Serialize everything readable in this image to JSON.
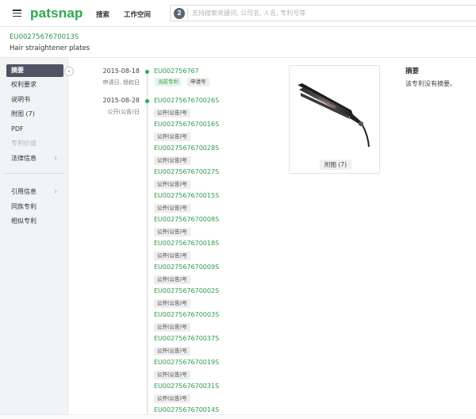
{
  "header": {
    "logo": "patsnap",
    "nav": [
      "搜索",
      "工作空间"
    ],
    "search": {
      "badge": "2",
      "placeholder": "支持搜索关键词, 公司名, 人名, 专利号等"
    }
  },
  "patent": {
    "number": "EU0027567670013S",
    "title": "Hair straightener plates"
  },
  "sidebar": {
    "items": [
      {
        "label": "摘要",
        "state": "active"
      },
      {
        "label": "权利要求",
        "state": "normal"
      },
      {
        "label": "说明书",
        "state": "normal"
      },
      {
        "label": "附图 (7)",
        "state": "normal"
      },
      {
        "label": "PDF",
        "state": "normal"
      },
      {
        "label": "专利价值",
        "state": "disabled"
      },
      {
        "label": "法律信息",
        "state": "normal",
        "arrow": "›"
      },
      {
        "label": "引用信息",
        "state": "normal",
        "arrow": "›"
      },
      {
        "label": "同族专利",
        "state": "normal"
      },
      {
        "label": "相似专利",
        "state": "normal"
      }
    ]
  },
  "timeline": {
    "first": {
      "date": "2015-08-18",
      "sub": "申请日, 授权日",
      "number": "EU002756767",
      "tags": [
        "当前专利",
        "申请号"
      ]
    },
    "second": {
      "date": "2015-08-28",
      "sub": "公开(公告)日"
    },
    "publications": [
      {
        "number": "EU0027567670026S",
        "tag": "公开(公告)号"
      },
      {
        "number": "EU0027567670016S",
        "tag": "公开(公告)号"
      },
      {
        "number": "EU0027567670028S",
        "tag": "公开(公告)号"
      },
      {
        "number": "EU0027567670027S",
        "tag": "公开(公告)号"
      },
      {
        "number": "EU0027567670015S",
        "tag": "公开(公告)号"
      },
      {
        "number": "EU0027567670008S",
        "tag": "公开(公告)号"
      },
      {
        "number": "EU0027567670018S",
        "tag": "公开(公告)号"
      },
      {
        "number": "EU0027567670009S",
        "tag": "公开(公告)号"
      },
      {
        "number": "EU0027567670002S",
        "tag": "公开(公告)号"
      },
      {
        "number": "EU0027567670003S",
        "tag": "公开(公告)号"
      },
      {
        "number": "EU0027567670037S",
        "tag": "公开(公告)号"
      },
      {
        "number": "EU0027567670019S",
        "tag": "公开(公告)号"
      },
      {
        "number": "EU0027567670031S",
        "tag": "公开(公告)号"
      },
      {
        "number": "EU0027567670014S",
        "tag": ""
      }
    ]
  },
  "figure": {
    "caption": "附图 (7)"
  },
  "abstract": {
    "title": "摘要",
    "text": "该专利没有摘要。"
  },
  "colors": {
    "brand": "#2fa84f",
    "link": "#2e9a47",
    "active_nav": "#4d5564"
  },
  "icons": [
    "menu-icon",
    "chevron-left-icon",
    "chevron-right-icon"
  ]
}
